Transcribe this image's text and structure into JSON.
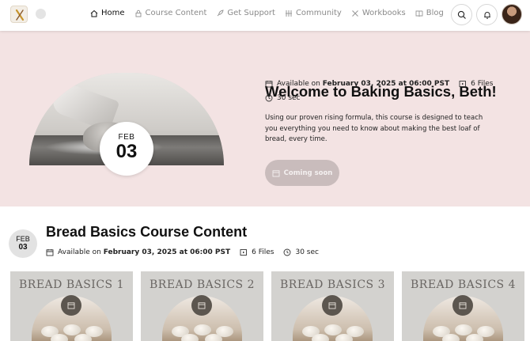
{
  "nav": {
    "items": [
      {
        "label": "Home",
        "icon": "home-icon",
        "active": true
      },
      {
        "label": "Course Content",
        "icon": "lock-icon",
        "active": false
      },
      {
        "label": "Get Support",
        "icon": "rocket-icon",
        "active": false
      },
      {
        "label": "Community",
        "icon": "community-icon",
        "active": false
      },
      {
        "label": "Workbooks",
        "icon": "tools-icon",
        "active": false
      },
      {
        "label": "Blog",
        "icon": "book-icon",
        "active": false
      }
    ]
  },
  "hero": {
    "date_month": "FEB",
    "date_day": "03",
    "title": "Welcome to Baking Basics, Beth!",
    "available_prefix": "Available on",
    "available_date": "February 03, 2025 at 06:00 PST",
    "files": "6 Files",
    "duration": "30 sec",
    "description": "Using our proven rising formula, this course is designed to teach you everything you need to know about making the best loaf of bread, every time.",
    "button_label": "Coming soon"
  },
  "section": {
    "date_month": "FEB",
    "date_day": "03",
    "title": "Bread Basics Course Content",
    "available_prefix": "Available on",
    "available_date": "February 03, 2025 at 06:00 PST",
    "files": "6 Files",
    "duration": "30 sec"
  },
  "cards": [
    {
      "title": "BREAD BASICS 1"
    },
    {
      "title": "BREAD BASICS 2"
    },
    {
      "title": "BREAD BASICS 3"
    },
    {
      "title": "BREAD BASICS 4"
    }
  ],
  "colors": {
    "hero_bg": "#f3e3e3",
    "button_disabled": "#c9bcbc",
    "card_bg": "#d3d2cf"
  }
}
